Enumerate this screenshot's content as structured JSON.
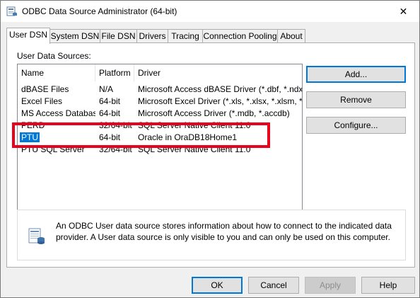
{
  "window": {
    "title": "ODBC Data Source Administrator (64-bit)",
    "close_glyph": "✕"
  },
  "tabs": [
    {
      "label": "User DSN",
      "active": true
    },
    {
      "label": "System DSN"
    },
    {
      "label": "File DSN"
    },
    {
      "label": "Drivers"
    },
    {
      "label": "Tracing"
    },
    {
      "label": "Connection Pooling"
    },
    {
      "label": "About"
    }
  ],
  "user_dsn": {
    "sources_label": "User Data Sources:",
    "columns": [
      "Name",
      "Platform",
      "Driver"
    ],
    "rows": [
      {
        "name": "dBASE Files",
        "platform": "N/A",
        "driver": "Microsoft Access dBASE Driver (*.dbf, *.ndx, *.m"
      },
      {
        "name": "Excel Files",
        "platform": "64-bit",
        "driver": "Microsoft Excel Driver (*.xls, *.xlsx, *.xlsm, *.xlsb"
      },
      {
        "name": "MS Access Database",
        "platform": "64-bit",
        "driver": "Microsoft Access Driver (*.mdb, *.accdb)"
      },
      {
        "name": "PERD",
        "platform": "32/64-bit",
        "driver": "SQL Server Native Client 11.0"
      },
      {
        "name": "PTU",
        "platform": "64-bit",
        "driver": "Oracle in OraDB18Home1",
        "selected": true
      },
      {
        "name": "PTU SQL Server",
        "platform": "32/64-bit",
        "driver": "SQL Server Native Client 11.0"
      }
    ],
    "buttons": {
      "add": "Add...",
      "remove": "Remove",
      "configure": "Configure..."
    },
    "info_text": "An ODBC User data source stores information about how to connect to the indicated data provider.   A User data source is only visible to you and can only be used on this computer."
  },
  "footer": {
    "ok": "OK",
    "cancel": "Cancel",
    "apply": "Apply",
    "help": "Help"
  },
  "colors": {
    "selection": "#0078d7",
    "highlight_annotation": "#e8001c"
  }
}
